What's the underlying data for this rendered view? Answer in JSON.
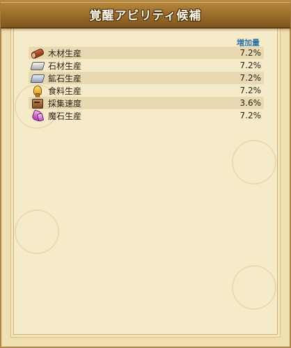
{
  "window": {
    "title": "覚醒アビリティ候補"
  },
  "list": {
    "header_increase": "増加量",
    "items": [
      {
        "icon": "wood-icon",
        "label": "木材生産",
        "value": "7.2%"
      },
      {
        "icon": "stone-icon",
        "label": "石材生産",
        "value": "7.2%"
      },
      {
        "icon": "ore-icon",
        "label": "鉱石生産",
        "value": "7.2%"
      },
      {
        "icon": "food-icon",
        "label": "食料生産",
        "value": "7.2%"
      },
      {
        "icon": "gather-icon",
        "label": "採集速度",
        "value": "3.6%"
      },
      {
        "icon": "magic-stone-icon",
        "label": "魔石生産",
        "value": "7.2%"
      }
    ]
  },
  "colors": {
    "title_bar": "#9a6c29",
    "header_text": "#2f73a8",
    "parchment": "#f6ebc9"
  }
}
